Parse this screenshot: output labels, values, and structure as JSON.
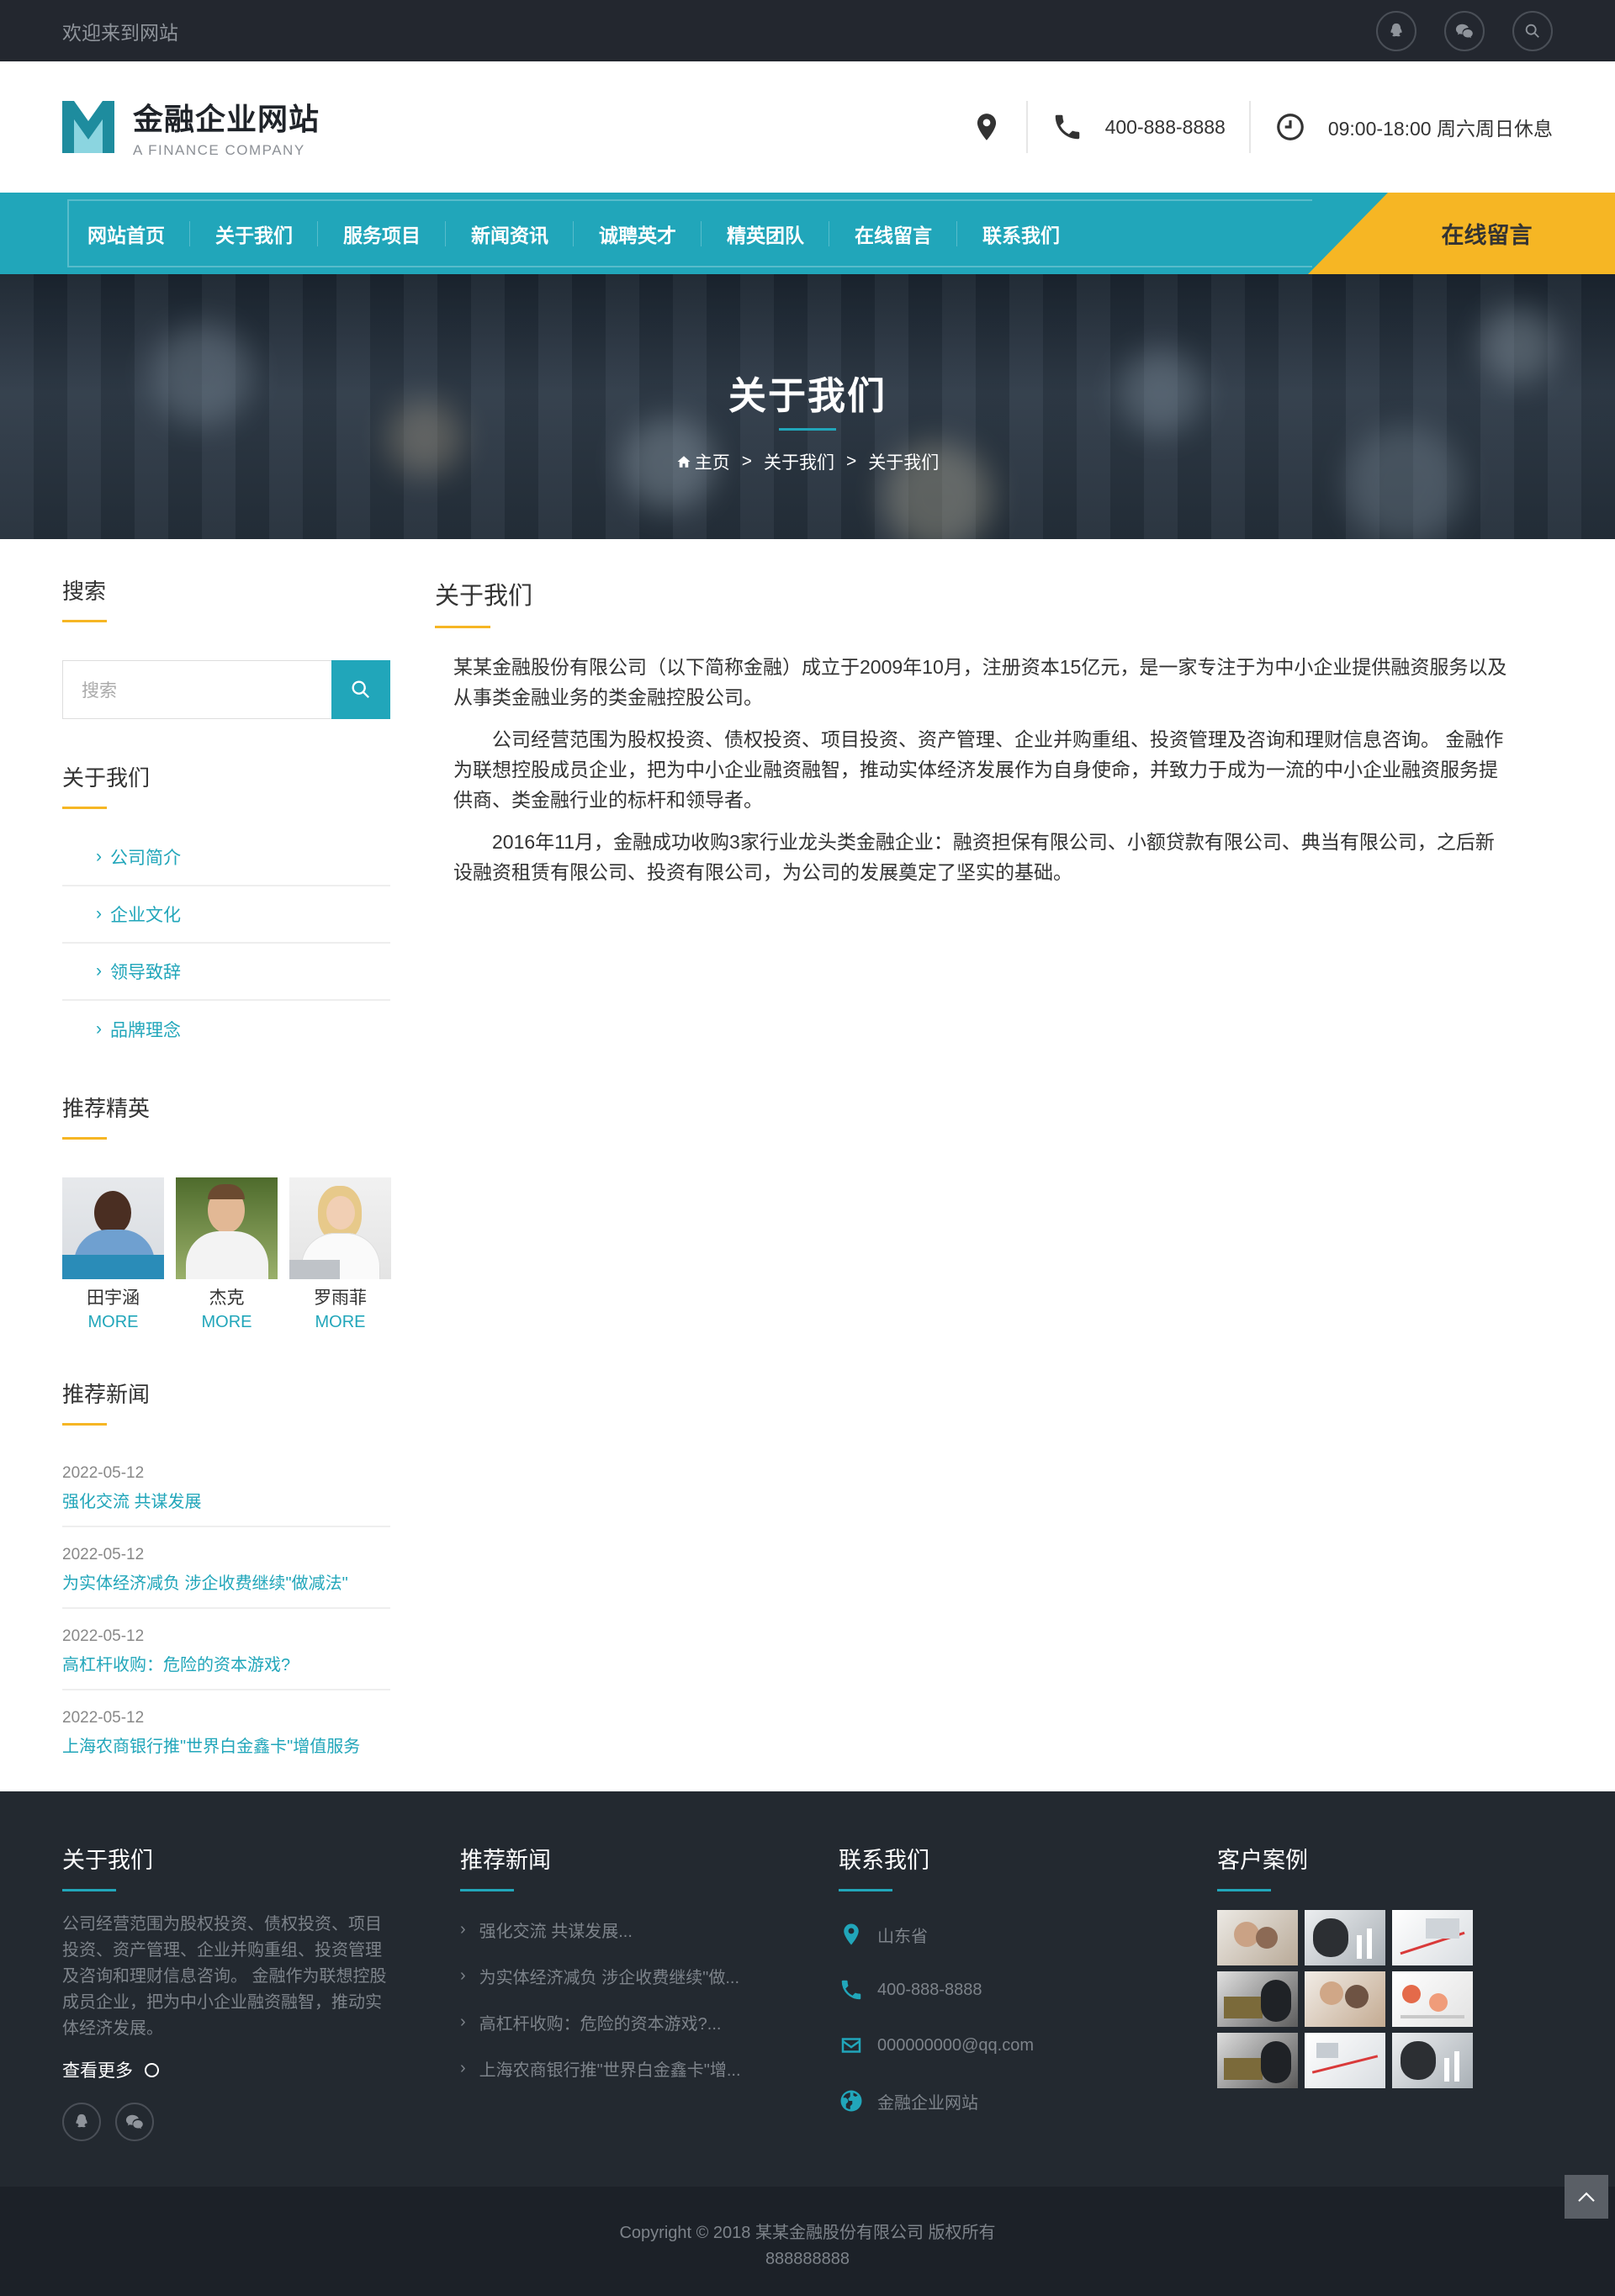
{
  "topbar": {
    "welcome": "欢迎来到网站",
    "icons": [
      "qq-icon",
      "wechat-icon",
      "search-icon"
    ]
  },
  "header": {
    "logo_title": "金融企业网站",
    "logo_subtitle": "A FINANCE COMPANY",
    "phone": "400-888-8888",
    "hours": "09:00-18:00 周六周日休息"
  },
  "nav": {
    "items": [
      "网站首页",
      "关于我们",
      "服务项目",
      "新闻资讯",
      "诚聘英才",
      "精英团队",
      "在线留言",
      "联系我们"
    ],
    "cta": "在线留言"
  },
  "banner": {
    "title": "关于我们",
    "crumb": [
      "主页",
      "关于我们",
      "关于我们"
    ],
    "sep": ">"
  },
  "sidebar": {
    "search_title": "搜索",
    "search_placeholder": "搜索",
    "about_title": "关于我们",
    "categories": [
      "公司简介",
      "企业文化",
      "领导致辞",
      "品牌理念"
    ],
    "team_title": "推荐精英",
    "team": [
      {
        "name": "田宇涵",
        "more": "MORE"
      },
      {
        "name": "杰克",
        "more": "MORE"
      },
      {
        "name": "罗雨菲",
        "more": "MORE"
      }
    ],
    "news_title": "推荐新闻",
    "news": [
      {
        "date": "2022-05-12",
        "title": "强化交流 共谋发展"
      },
      {
        "date": "2022-05-12",
        "title": "为实体经济减负 涉企收费继续\"做减法\""
      },
      {
        "date": "2022-05-12",
        "title": "高杠杆收购：危险的资本游戏?"
      },
      {
        "date": "2022-05-12",
        "title": "上海农商银行推\"世界白金鑫卡\"增值服务"
      }
    ]
  },
  "content": {
    "title": "关于我们",
    "paragraphs": [
      "某某金融股份有限公司（以下简称金融）成立于2009年10月，注册资本15亿元，是一家专注于为中小企业提供融资服务以及从事类金融业务的类金融控股公司。",
      "公司经营范围为股权投资、债权投资、项目投资、资产管理、企业并购重组、投资管理及咨询和理财信息咨询。 金融作为联想控股成员企业，把为中小企业融资融智，推动实体经济发展作为自身使命，并致力于成为一流的中小企业融资服务提供商、类金融行业的标杆和领导者。",
      "2016年11月，金融成功收购3家行业龙头类金融企业：融资担保有限公司、小额贷款有限公司、典当有限公司，之后新设融资租赁有限公司、投资有限公司，为公司的发展奠定了坚实的基础。"
    ]
  },
  "footer": {
    "about_title": "关于我们",
    "about_text": "公司经营范围为股权投资、债权投资、项目投资、资产管理、企业并购重组、投资管理及咨询和理财信息咨询。 金融作为联想控股成员企业，把为中小企业融资融智，推动实体经济发展。",
    "more": "查看更多",
    "news_title": "推荐新闻",
    "news": [
      "强化交流 共谋发展...",
      "为实体经济减负 涉企收费继续\"做...",
      "高杠杆收购：危险的资本游戏?...",
      "上海农商银行推\"世界白金鑫卡\"增..."
    ],
    "contact_title": "联系我们",
    "contact": {
      "address": "山东省",
      "phone": "400-888-8888",
      "email": "000000000@qq.com",
      "site": "金融企业网站"
    },
    "cases_title": "客户案例",
    "copyright": "Copyright © 2018 某某金融股份有限公司 版权所有",
    "icp": "888888888"
  },
  "colors": {
    "primary": "#21a6ba",
    "accent": "#f6b624",
    "dark": "#23272f",
    "footer": "#232930"
  }
}
